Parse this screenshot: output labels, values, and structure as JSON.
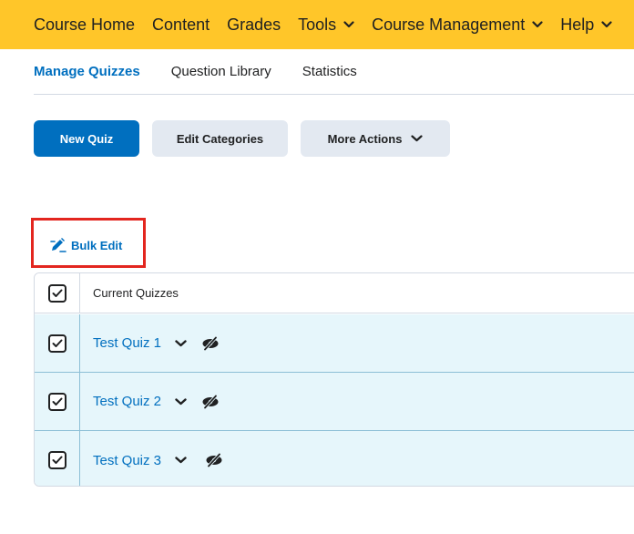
{
  "topnav": {
    "items": [
      {
        "label": "Course Home",
        "has_menu": false
      },
      {
        "label": "Content",
        "has_menu": false
      },
      {
        "label": "Grades",
        "has_menu": false
      },
      {
        "label": "Tools",
        "has_menu": true
      },
      {
        "label": "Course Management",
        "has_menu": true
      },
      {
        "label": "Help",
        "has_menu": true
      }
    ],
    "background_color": "#ffc629"
  },
  "tabs": [
    {
      "label": "Manage Quizzes",
      "active": true
    },
    {
      "label": "Question Library",
      "active": false
    },
    {
      "label": "Statistics",
      "active": false
    }
  ],
  "toolbar": {
    "new_quiz_label": "New Quiz",
    "edit_categories_label": "Edit Categories",
    "more_actions_label": "More Actions"
  },
  "bulk_edit": {
    "label": "Bulk Edit",
    "icon": "pencil-edit-icon",
    "highlight_color": "#e3261f"
  },
  "table": {
    "header": {
      "label": "Current Quizzes",
      "checked": true
    },
    "rows": [
      {
        "name": "Test Quiz 1",
        "checked": true,
        "status_icon": "hidden-eye-icon"
      },
      {
        "name": "Test Quiz 2",
        "checked": true,
        "status_icon": "hidden-eye-icon"
      },
      {
        "name": "Test Quiz 3",
        "checked": true,
        "status_icon": "hidden-eye-icon"
      }
    ]
  },
  "colors": {
    "primary": "#006fbf",
    "row_selected": "#e6f6fb"
  }
}
